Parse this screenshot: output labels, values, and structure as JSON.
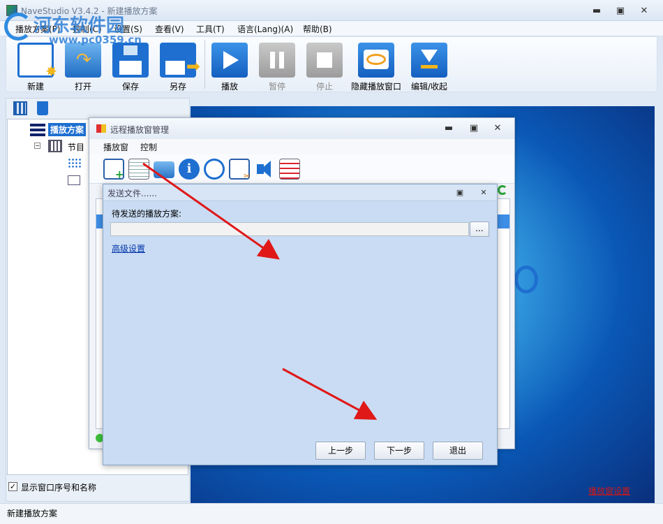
{
  "window": {
    "title": "NaveStudio V3.4.2 - 新建播放方案",
    "min_symbol": "▬",
    "max_symbol": "▣",
    "close_symbol": "✕"
  },
  "watermark": {
    "line1": "河东软件园",
    "line2": "www.pc0359.cn"
  },
  "menu": [
    "播放方案(F)",
    "控制(C)",
    "设置(S)",
    "查看(V)",
    "工具(T)",
    "语言(Lang)(A)",
    "帮助(B)"
  ],
  "toolbar": {
    "new": "新建",
    "open": "打开",
    "save": "保存",
    "save_as": "另存",
    "play": "播放",
    "pause": "暂停",
    "stop": "停止",
    "hide_window": "隐藏播放窗口",
    "edit_collapse": "编辑/收起"
  },
  "tree": {
    "root": "播放方案",
    "child": "节目"
  },
  "show_window_checkbox": {
    "label": "显示窗口序号和名称",
    "checked": true
  },
  "status_text": "新建播放方案",
  "preview_link": "播放窗设置",
  "remote_dialog": {
    "title": "远程播放窗管理",
    "menu": [
      "播放窗",
      "控制"
    ],
    "icons": [
      "add-window-icon",
      "document-icon",
      "folder-icon",
      "info-icon",
      "clock-icon",
      "video-edit-icon",
      "speaker-icon",
      "list-icon"
    ]
  },
  "send_dialog": {
    "title": "发送文件......",
    "field_label": "待发送的播放方案:",
    "field_value": "",
    "browse_label": "...",
    "advanced_link": "高级设置",
    "prev_label": "上一步",
    "next_label": "下一步",
    "exit_label": "退出"
  },
  "colors": {
    "accent": "#1e6fd0",
    "annotation_arrow": "#e01818"
  }
}
